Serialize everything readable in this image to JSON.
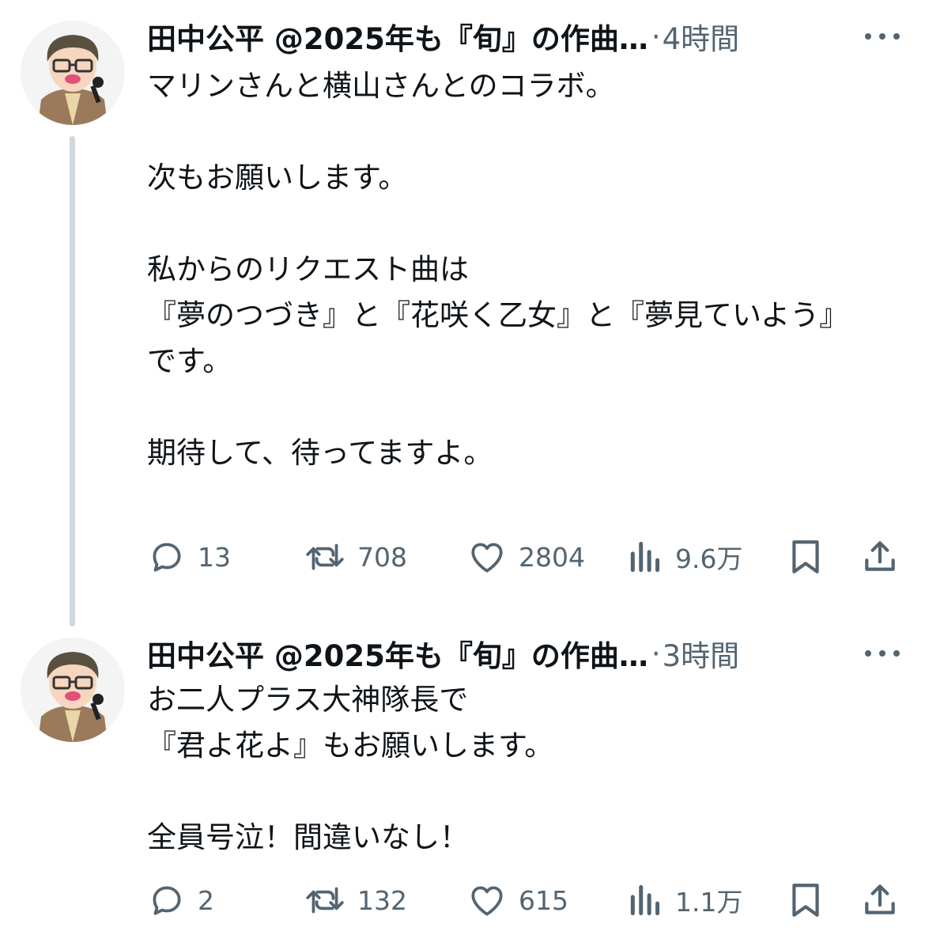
{
  "tweets": [
    {
      "author": "田中公平 @2025年も『旬』の作曲…",
      "separator": "·",
      "time": "4時間",
      "body": "マリンさんと横山さんとのコラボ。\n\n次もお願いします。\n\n私からのリクエスト曲は\n『夢のつづき』と『花咲く乙女』と『夢見ていよう』\nです。\n\n期待して、待ってますよ。",
      "replies": "13",
      "retweets": "708",
      "likes": "2804",
      "views": "9.6万"
    },
    {
      "author": "田中公平 @2025年も『旬』の作曲…",
      "separator": "·",
      "time": "3時間",
      "body": "お二人プラス大神隊長で\n『君よ花よ』もお願いします。\n\n全員号泣！間違いなし！",
      "replies": "2",
      "retweets": "132",
      "likes": "615",
      "views": "1.1万"
    }
  ],
  "icons": {
    "reply": "reply-icon",
    "retweet": "retweet-icon",
    "like": "heart-icon",
    "views": "views-icon",
    "bookmark": "bookmark-icon",
    "share": "share-icon",
    "more": "more-icon"
  },
  "colors": {
    "text": "#0f1419",
    "secondary": "#536471",
    "thread_line": "#cfd9de"
  }
}
